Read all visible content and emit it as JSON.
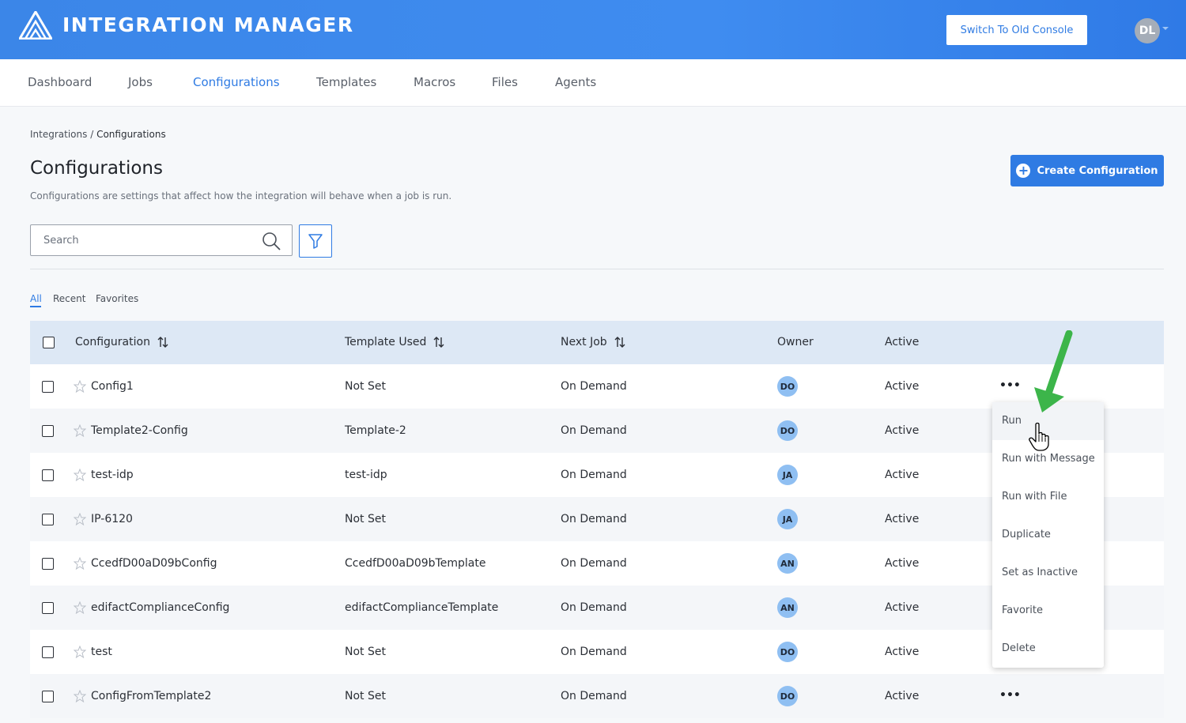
{
  "header": {
    "app_title": "INTEGRATION MANAGER",
    "old_console_label": "Switch To Old Console",
    "user_initials": "DL",
    "logo_icon": "mountain-logo-icon"
  },
  "nav": {
    "items": [
      {
        "label": "Dashboard",
        "active": false
      },
      {
        "label": "Jobs",
        "active": false
      },
      {
        "label": "Configurations",
        "active": true
      },
      {
        "label": "Templates",
        "active": false
      },
      {
        "label": "Macros",
        "active": false
      },
      {
        "label": "Files",
        "active": false
      },
      {
        "label": "Agents",
        "active": false
      }
    ]
  },
  "breadcrumb": {
    "parent": "Integrations",
    "separator": "/",
    "current": "Configurations"
  },
  "page": {
    "title": "Configurations",
    "description": "Configurations are settings that affect how the integration will behave when a job is run.",
    "create_label": "Create Configuration"
  },
  "search": {
    "placeholder": "Search",
    "value": ""
  },
  "tabs": [
    {
      "label": "All",
      "active": true
    },
    {
      "label": "Recent",
      "active": false
    },
    {
      "label": "Favorites",
      "active": false
    }
  ],
  "table": {
    "columns": {
      "configuration": "Configuration",
      "template_used": "Template Used",
      "next_job": "Next Job",
      "owner": "Owner",
      "active": "Active"
    },
    "rows": [
      {
        "name": "Config1",
        "template": "Not Set",
        "next_job": "On Demand",
        "owner": "DO",
        "status": "Active"
      },
      {
        "name": "Template2-Config",
        "template": "Template-2",
        "next_job": "On Demand",
        "owner": "DO",
        "status": "Active"
      },
      {
        "name": "test-idp",
        "template": "test-idp",
        "next_job": "On Demand",
        "owner": "JA",
        "status": "Active"
      },
      {
        "name": "IP-6120",
        "template": "Not Set",
        "next_job": "On Demand",
        "owner": "JA",
        "status": "Active"
      },
      {
        "name": "CcedfD00aD09bConfig",
        "template": "CcedfD00aD09bTemplate",
        "next_job": "On Demand",
        "owner": "AN",
        "status": "Active"
      },
      {
        "name": "edifactComplianceConfig",
        "template": "edifactComplianceTemplate",
        "next_job": "On Demand",
        "owner": "AN",
        "status": "Active"
      },
      {
        "name": "test",
        "template": "Not Set",
        "next_job": "On Demand",
        "owner": "DO",
        "status": "Active"
      },
      {
        "name": "ConfigFromTemplate2",
        "template": "Not Set",
        "next_job": "On Demand",
        "owner": "DO",
        "status": "Active"
      }
    ]
  },
  "row_menu": {
    "items": [
      "Run",
      "Run with Message",
      "Run with File",
      "Duplicate",
      "Set as Inactive",
      "Favorite",
      "Delete"
    ],
    "hovered": "Run"
  },
  "colors": {
    "header_blue": "#3b86e8",
    "accent": "#2f7be3",
    "table_header_bg": "#dde8f5",
    "owner_badge": "#8fbff2",
    "annotation_arrow": "#3cb54a"
  }
}
